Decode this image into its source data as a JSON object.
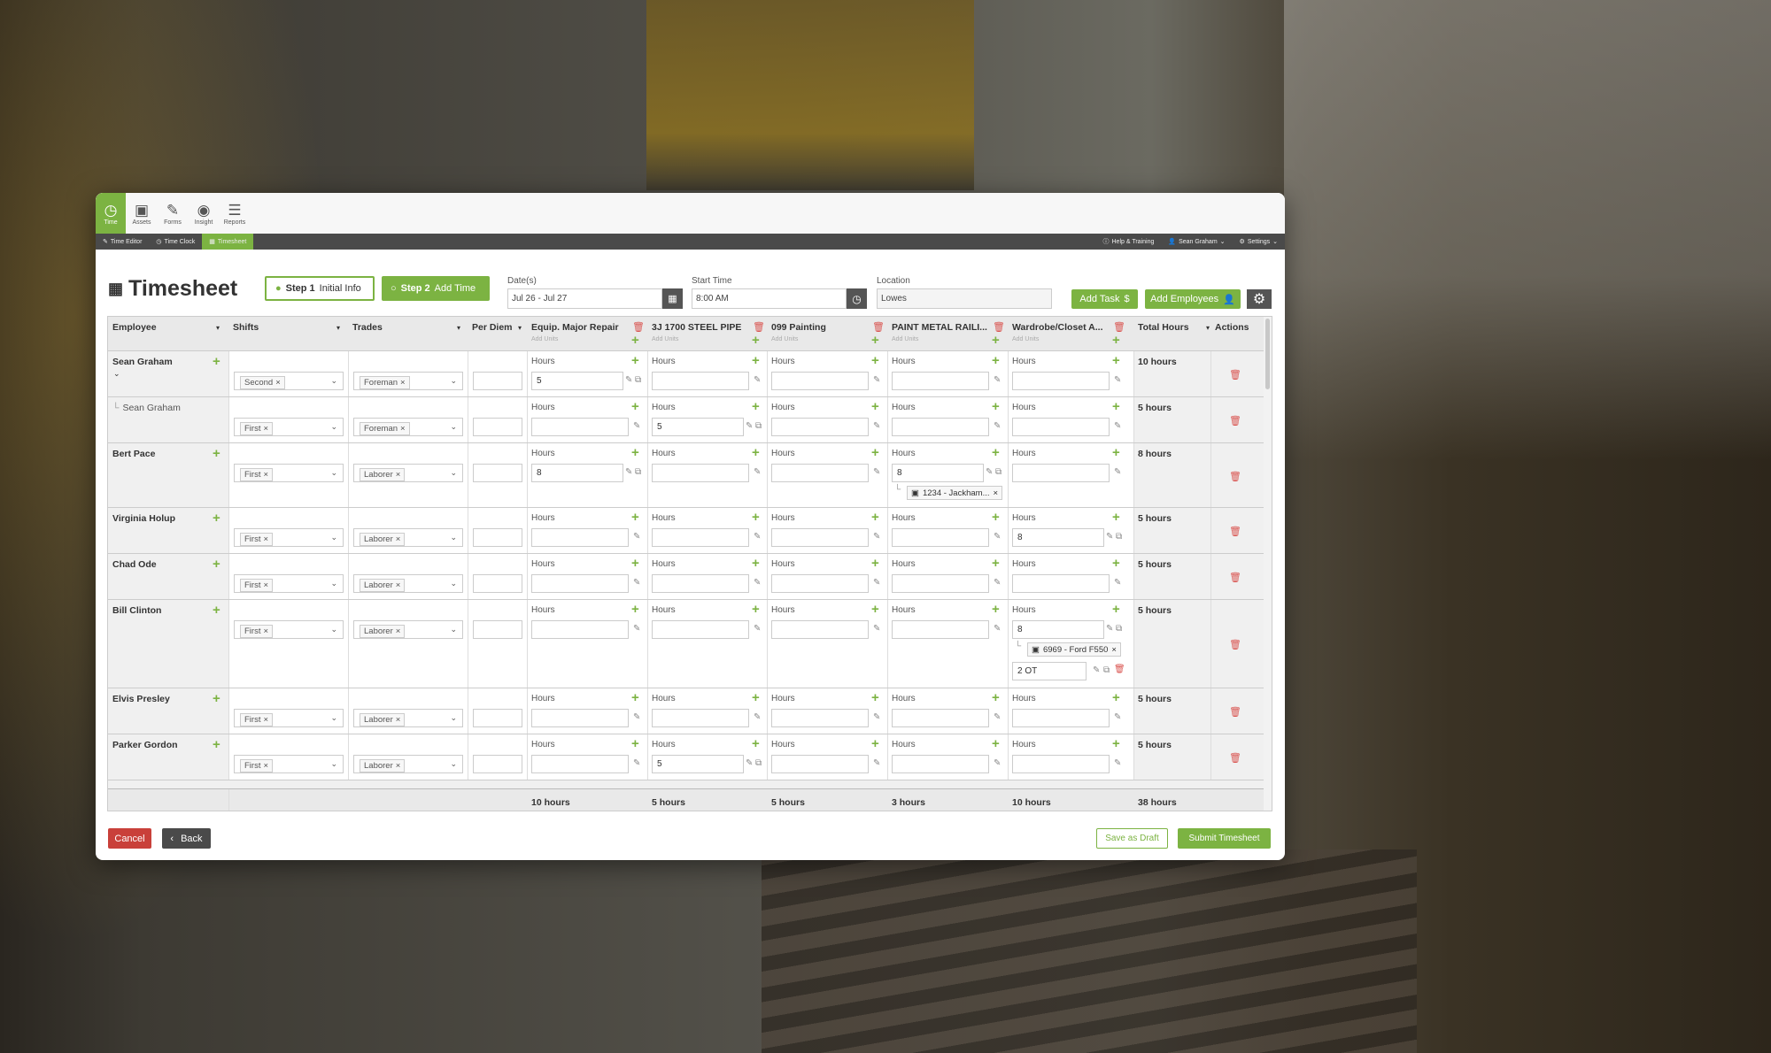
{
  "nav": {
    "items": [
      {
        "label": "Time",
        "icon": "clock-icon",
        "active": true
      },
      {
        "label": "Assets",
        "icon": "briefcase-icon"
      },
      {
        "label": "Forms",
        "icon": "pencil-square-icon"
      },
      {
        "label": "Insight",
        "icon": "eye-icon"
      },
      {
        "label": "Reports",
        "icon": "report-icon"
      }
    ]
  },
  "subnav": {
    "items": [
      {
        "label": "Time Editor"
      },
      {
        "label": "Time Clock"
      },
      {
        "label": "Timesheet",
        "active": true
      }
    ],
    "help": "Help & Training",
    "user": "Sean Graham",
    "settings": "Settings"
  },
  "page": {
    "title": "Timesheet",
    "step1_num": "Step 1",
    "step1_label": "Initial Info",
    "step2_num": "Step 2",
    "step2_label": "Add Time",
    "dates_label": "Date(s)",
    "dates_value": "Jul 26 - Jul 27",
    "start_label": "Start Time",
    "start_value": "8:00 AM",
    "location_label": "Location",
    "location_value": "Lowes",
    "add_task": "Add Task",
    "add_employees": "Add Employees"
  },
  "table": {
    "headers": {
      "employee": "Employee",
      "shifts": "Shifts",
      "trades": "Trades",
      "per_diem": "Per Diem",
      "tasks": [
        "Equip. Major Repair",
        "3J 1700 STEEL PIPE",
        "099 Painting",
        "PAINT METAL RAILI...",
        "Wardrobe/Closet A..."
      ],
      "add_units": "Add Units",
      "total_hours": "Total Hours",
      "actions": "Actions"
    },
    "hours_label": "Hours",
    "rows": [
      {
        "name": "Sean Graham",
        "shift": "Second",
        "trade": "Foreman",
        "hours": [
          "5",
          "",
          "",
          "",
          ""
        ],
        "total": "10 hours"
      },
      {
        "name": "Sean Graham",
        "sub": true,
        "shift": "First",
        "trade": "Foreman",
        "hours": [
          "",
          "5",
          "",
          "",
          ""
        ],
        "total": "5 hours"
      },
      {
        "name": "Bert Pace",
        "shift": "First",
        "trade": "Laborer",
        "hours": [
          "8",
          "",
          "",
          "8",
          ""
        ],
        "total": "8 hours",
        "chip": "1234 - Jackham..."
      },
      {
        "name": "Virginia Holup",
        "shift": "First",
        "trade": "Laborer",
        "hours": [
          "",
          "",
          "",
          "",
          "8"
        ],
        "total": "5 hours"
      },
      {
        "name": "Chad Ode",
        "shift": "First",
        "trade": "Laborer",
        "hours": [
          "",
          "",
          "",
          "",
          ""
        ],
        "total": "5 hours"
      },
      {
        "name": "Bill Clinton",
        "shift": "First",
        "trade": "Laborer",
        "hours": [
          "",
          "",
          "",
          "",
          "8"
        ],
        "total": "5 hours",
        "chip": "6969 - Ford F550",
        "extra": "2 OT"
      },
      {
        "name": "Elvis Presley",
        "shift": "First",
        "trade": "Laborer",
        "hours": [
          "",
          "",
          "",
          "",
          ""
        ],
        "total": "5 hours"
      },
      {
        "name": "Parker Gordon",
        "shift": "First",
        "trade": "Laborer",
        "hours": [
          "",
          "5",
          "",
          "",
          ""
        ],
        "total": "5 hours"
      }
    ],
    "footer": {
      "task_totals": [
        "10 hours",
        "5 hours",
        "5 hours",
        "3 hours",
        "10 hours"
      ],
      "grand_total": "38 hours"
    }
  },
  "buttons": {
    "cancel": "Cancel",
    "back": "Back",
    "save_draft": "Save as Draft",
    "submit": "Submit Timesheet"
  },
  "colors": {
    "accent": "#7cb342",
    "danger": "#d9534f",
    "dark": "#4a4a4a"
  }
}
